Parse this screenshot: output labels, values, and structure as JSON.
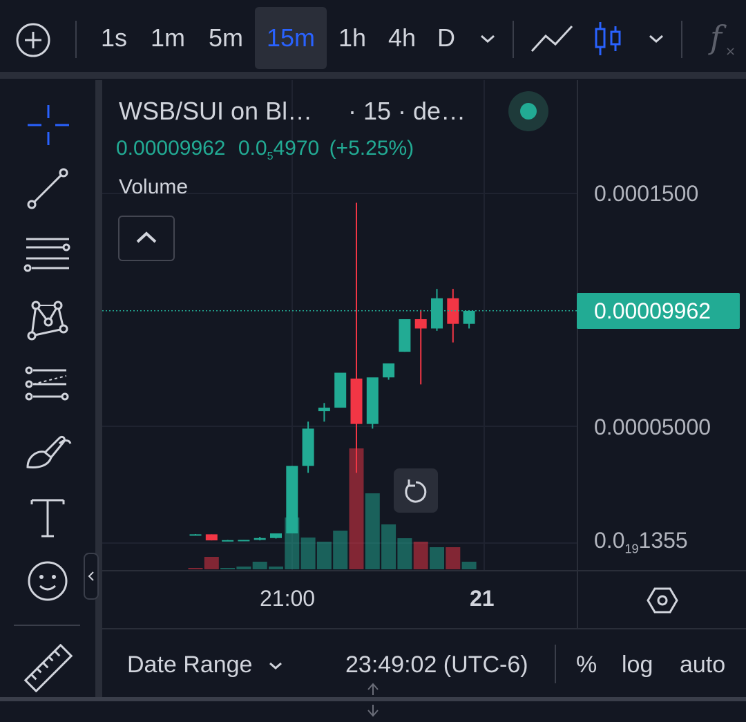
{
  "toolbar": {
    "timeframes": [
      "1s",
      "1m",
      "5m",
      "15m",
      "1h",
      "4h",
      "D"
    ],
    "active_timeframe": "15m",
    "icons": [
      "add-circle-icon",
      "chevron-down-icon",
      "line-chart-icon",
      "candlestick-icon",
      "chevron-down-icon",
      "function-icon"
    ]
  },
  "left_tools": [
    "crosshair-icon",
    "trend-line-icon",
    "horizontal-lines-icon",
    "pattern-icon",
    "fib-retracement-icon",
    "brush-icon",
    "text-icon",
    "emoji-icon",
    "ruler-icon"
  ],
  "legend": {
    "title": "WSB/SUI on Bl…",
    "interval": "· 15 · de…",
    "price": "0.00009962",
    "change_prefix": "0.0",
    "change_zeros": "5",
    "change_rest": "4970",
    "change_pct": "(+5.25%)",
    "volume_label": "Volume"
  },
  "price_axis": {
    "labels": [
      "0.0001500",
      "0.00005000"
    ],
    "low_prefix": "0.0",
    "low_zeros": "19",
    "low_rest": "1355",
    "current": "0.00009962"
  },
  "time_axis": {
    "labels": [
      "21:00",
      "21"
    ]
  },
  "bottom": {
    "date_range": "Date Range",
    "time": "23:49:02 (UTC-6)",
    "percent": "%",
    "log": "log",
    "auto": "auto"
  },
  "colors": {
    "up": "#22ab94",
    "down": "#f23645",
    "accent": "#2962ff",
    "bg": "#131722"
  },
  "chart_data": {
    "type": "candlestick",
    "candles": [
      {
        "o": 3.6e-06,
        "h": 3.7e-06,
        "l": 3.5e-06,
        "c": 3.6e-06
      },
      {
        "o": 3.6e-06,
        "h": 3.6e-06,
        "l": 1e-06,
        "c": 1e-06
      },
      {
        "o": 1e-06,
        "h": 1.2e-06,
        "l": 8e-07,
        "c": 1.1e-06
      },
      {
        "o": 1.1e-06,
        "h": 1.2e-06,
        "l": 8e-07,
        "c": 1.2e-06
      },
      {
        "o": 1.2e-06,
        "h": 2.5e-06,
        "l": 1e-06,
        "c": 2e-06
      },
      {
        "o": 2e-06,
        "h": 4e-06,
        "l": 1.8e-06,
        "c": 4e-06
      },
      {
        "o": 4e-06,
        "h": 3.3e-05,
        "l": 4e-06,
        "c": 3.3e-05
      },
      {
        "o": 3.3e-05,
        "h": 5.2e-05,
        "l": 3e-05,
        "c": 4.9e-05
      },
      {
        "o": 5.65e-05,
        "h": 6e-05,
        "l": 5.2e-05,
        "c": 5.8e-05
      },
      {
        "o": 5.8e-05,
        "h": 7.3e-05,
        "l": 5.8e-05,
        "c": 7.3e-05
      },
      {
        "o": 7.05e-05,
        "h": 0.000146,
        "l": 3e-05,
        "c": 5.1e-05
      },
      {
        "o": 5.1e-05,
        "h": 6.3e-05,
        "l": 4.9e-05,
        "c": 7.1e-05
      },
      {
        "o": 7.1e-05,
        "h": 7.7e-05,
        "l": 7e-05,
        "c": 7.7e-05
      },
      {
        "o": 8.2e-05,
        "h": 9.2e-05,
        "l": 8.2e-05,
        "c": 9.6e-05
      },
      {
        "o": 9.6e-05,
        "h": 0.0001,
        "l": 6.8e-05,
        "c": 9.2e-05
      },
      {
        "o": 9.2e-05,
        "h": 0.000109,
        "l": 9.1e-05,
        "c": 0.000105
      },
      {
        "o": 0.000105,
        "h": 0.000109,
        "l": 8.6e-05,
        "c": 9.4e-05
      },
      {
        "o": 9.4e-05,
        "h": 9.9e-05,
        "l": 9.2e-05,
        "c": 9.96e-05
      }
    ],
    "volumes": [
      {
        "v": 2,
        "dir": "down"
      },
      {
        "v": 18,
        "dir": "down"
      },
      {
        "v": 2,
        "dir": "up"
      },
      {
        "v": 4,
        "dir": "up"
      },
      {
        "v": 11,
        "dir": "up"
      },
      {
        "v": 4,
        "dir": "up"
      },
      {
        "v": 75,
        "dir": "up"
      },
      {
        "v": 46,
        "dir": "up"
      },
      {
        "v": 40,
        "dir": "up"
      },
      {
        "v": 56,
        "dir": "up"
      },
      {
        "v": 175,
        "dir": "down"
      },
      {
        "v": 110,
        "dir": "up"
      },
      {
        "v": 65,
        "dir": "up"
      },
      {
        "v": 45,
        "dir": "up"
      },
      {
        "v": 40,
        "dir": "down"
      },
      {
        "v": 32,
        "dir": "up"
      },
      {
        "v": 32,
        "dir": "down"
      },
      {
        "v": 11,
        "dir": "up"
      }
    ],
    "ylim": [
      0,
      0.000163
    ]
  }
}
